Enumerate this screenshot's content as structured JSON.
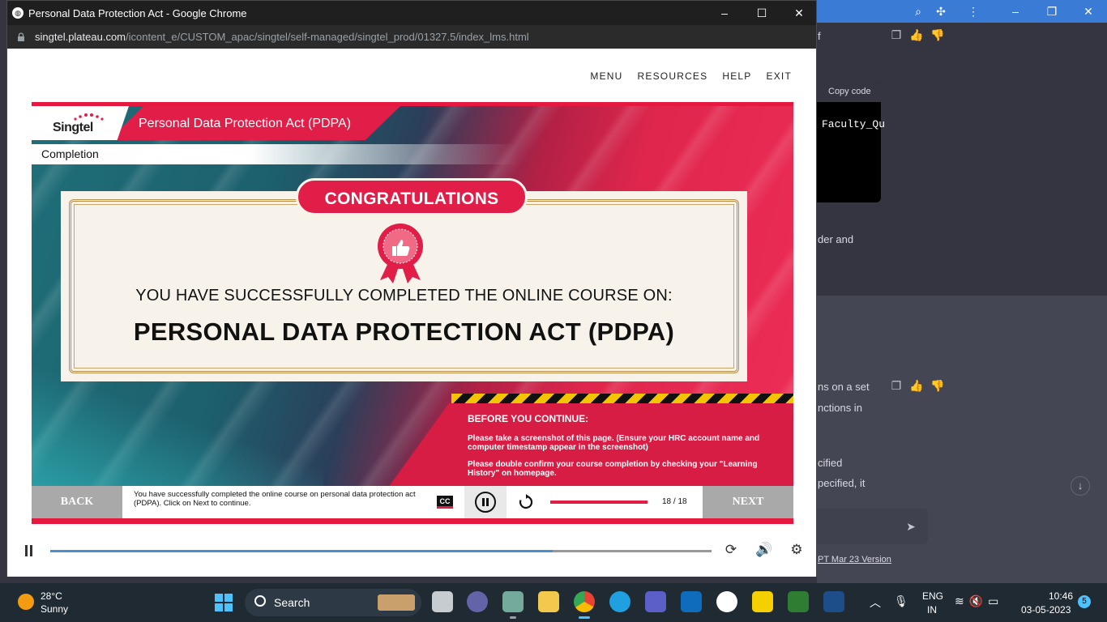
{
  "window": {
    "title": "Personal Data Protection Act - Google Chrome",
    "minimize": "–",
    "maximize": "☐",
    "close": "✕",
    "url_host": "singtel.plateau.com",
    "url_path": "/icontent_e/CUSTOM_apac/singtel/self-managed/singtel_prod/01327.5/index_lms.html"
  },
  "topnav": {
    "menu": "MENU",
    "resources": "RESOURCES",
    "help": "HELP",
    "exit": "EXIT"
  },
  "course": {
    "logo_text": "Singtel",
    "title": "Personal Data Protection Act (PDPA)",
    "section": "Completion",
    "congrats": "CONGRATULATIONS",
    "line1": "YOU HAVE SUCCESSFULLY COMPLETED THE ONLINE COURSE ON:",
    "line2": "PERSONAL DATA PROTECTION ACT (PDPA)",
    "notice_head": "BEFORE YOU CONTINUE:",
    "notice_p1": "Please take a screenshot of this page. (Ensure your  HRC account name and computer timestamp appear in the screenshot)",
    "notice_p2": "Please double confirm your course completion by checking your \"Learning History\" on homepage."
  },
  "player": {
    "back": "BACK",
    "next": "NEXT",
    "caption": "You have successfully completed the online course on personal data protection act (PDPA). Click on Next to continue.",
    "cc": "CC",
    "page_count": "18 / 18",
    "progress_fraction": 1.0
  },
  "video_controls": {
    "progress_fraction": 0.76,
    "replay_icon": "⟳",
    "volume_icon": "🔊",
    "settings_icon": "⚙"
  },
  "background_app": {
    "copy_code": "Copy code",
    "code_snippet": "Faculty_Qu",
    "text1": "f",
    "text2": "der and",
    "text3": "ns on a set",
    "text4": "nctions in",
    "text5": "cified",
    "text6": "pecified, it",
    "footer_link": "PT Mar 23 Version"
  },
  "taskbar": {
    "weather_temp": "28°C",
    "weather_desc": "Sunny",
    "search": "Search",
    "lang1": "ENG",
    "lang2": "IN",
    "time": "10:46",
    "date": "03-05-2023",
    "notifications": "5"
  },
  "colors": {
    "brand_red": "#e01e48",
    "taskbar": "#202a33",
    "accent_blue": "#4cc2ff"
  }
}
